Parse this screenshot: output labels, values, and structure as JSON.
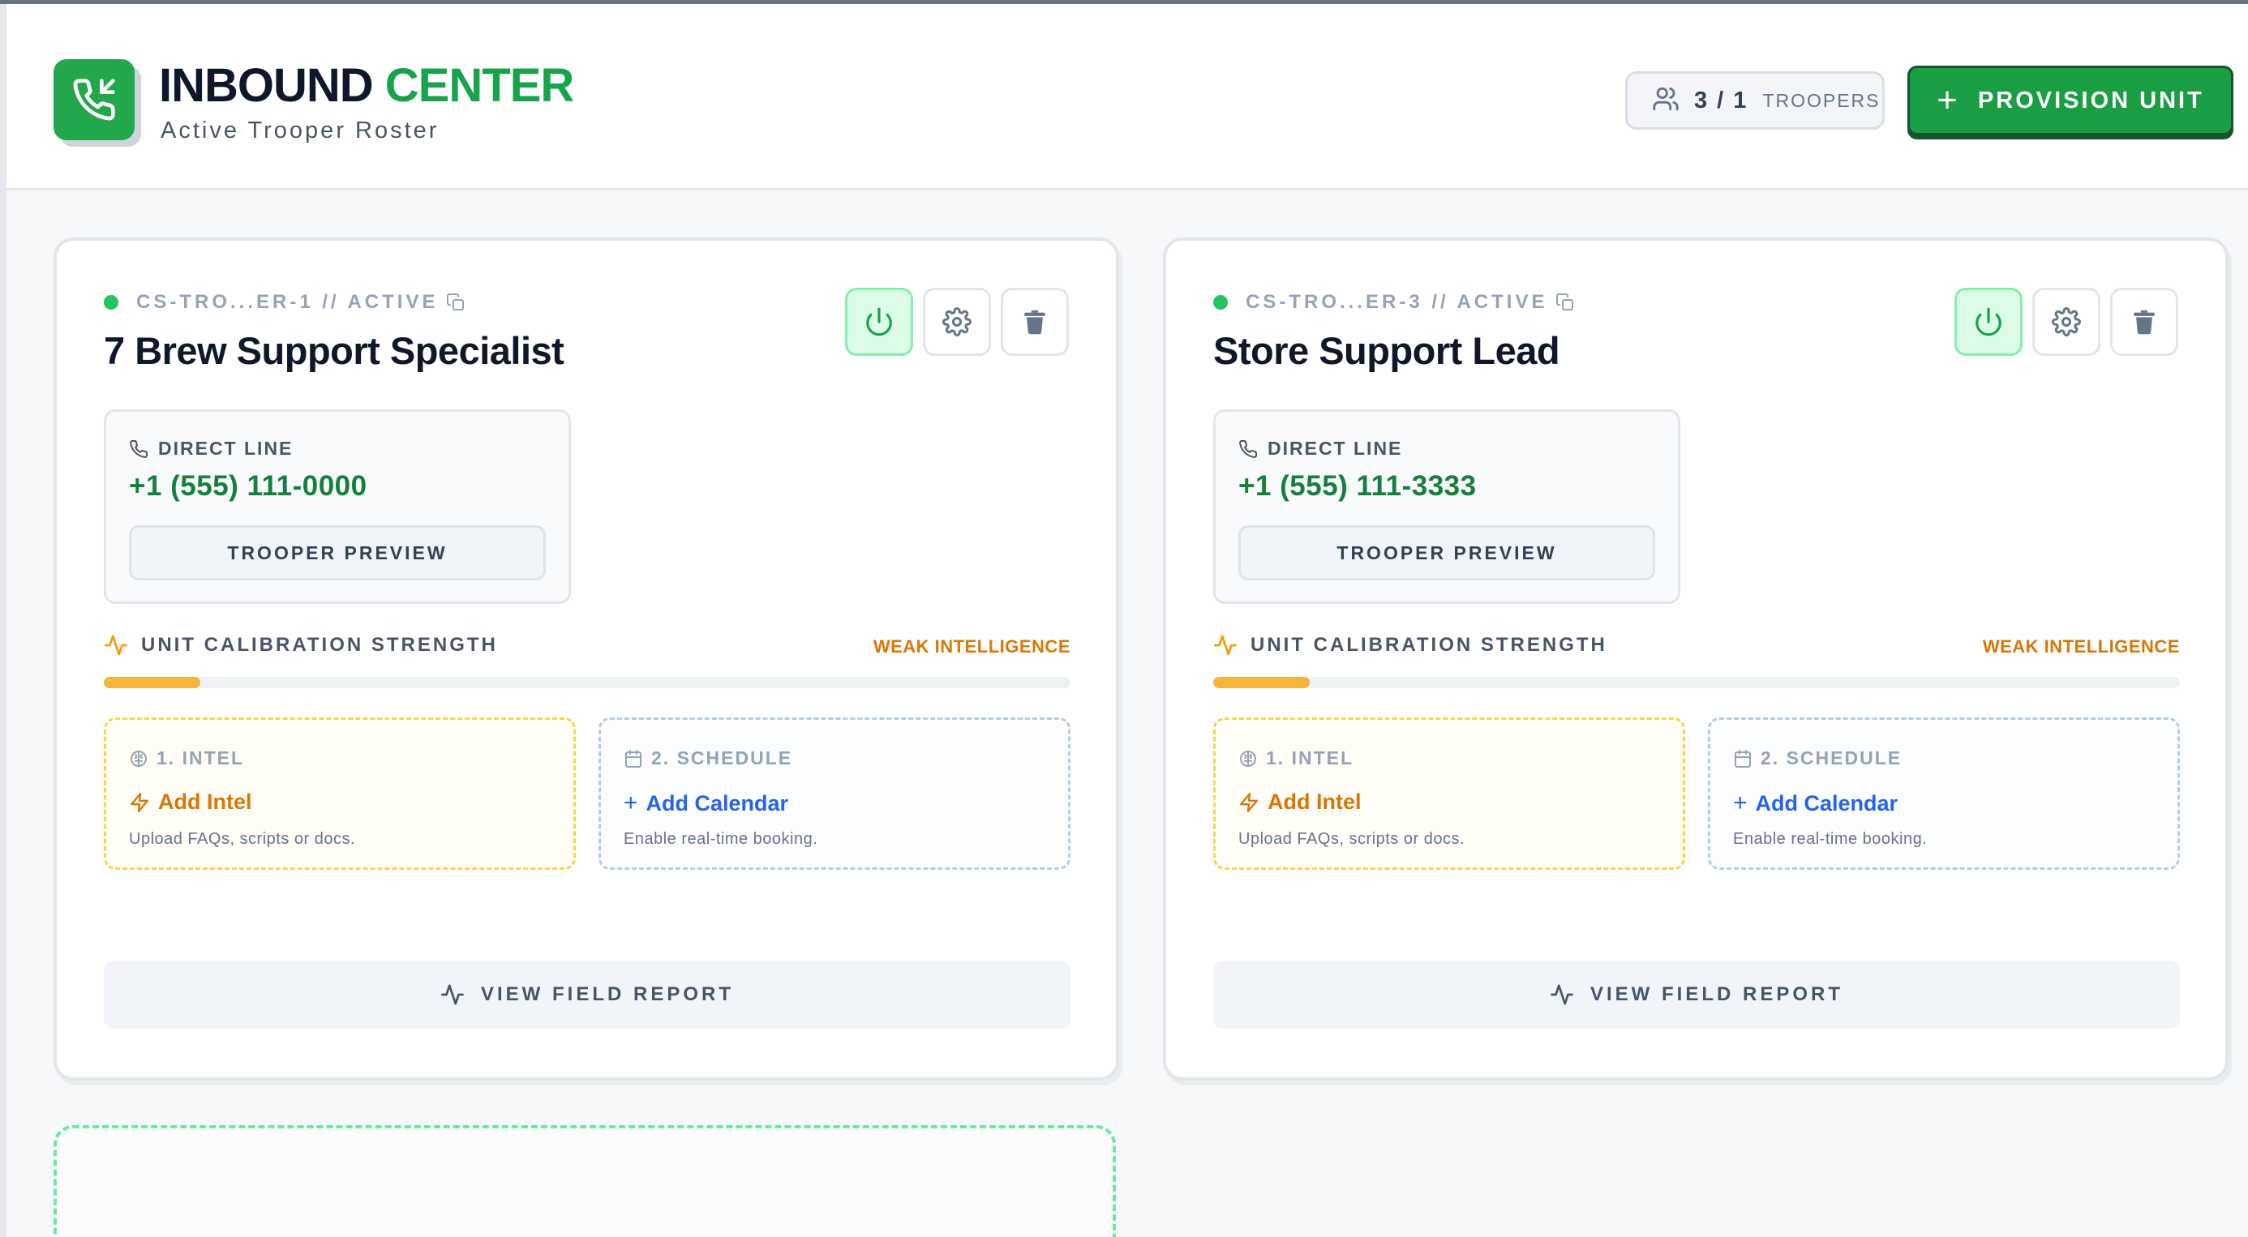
{
  "header": {
    "title_part1": "INBOUND",
    "title_part2": "CENTER",
    "subtitle": "Active Trooper Roster",
    "trooper_count": "3 / 1",
    "trooper_label": "TROOPERS",
    "provision_plus": "+",
    "provision_label": "PROVISION UNIT"
  },
  "colors": {
    "brand_green": "#22a74a",
    "accent_green_text": "#16a34a",
    "warning_orange": "#d97706",
    "link_blue": "#2563eb",
    "progress_fill": "#f5b43c"
  },
  "cards": [
    {
      "id_label": "CS-TRO...ER-1 // ACTIVE",
      "name": "7 Brew Support Specialist",
      "direct_line_label": "DIRECT LINE",
      "phone": "+1 (555) 111-0000",
      "preview_label": "TROOPER PREVIEW",
      "calibration_label": "UNIT CALIBRATION STRENGTH",
      "calibration_status": "WEAK INTELLIGENCE",
      "calibration_level": 0.1,
      "intel_label": "1. INTEL",
      "intel_action": "Add Intel",
      "intel_desc": "Upload FAQs, scripts or docs.",
      "schedule_label": "2. SCHEDULE",
      "schedule_plus": "+",
      "schedule_action": "Add Calendar",
      "schedule_desc": "Enable real-time booking.",
      "report_label": "VIEW FIELD REPORT"
    },
    {
      "id_label": "CS-TRO...ER-3 // ACTIVE",
      "name": "Store Support Lead",
      "direct_line_label": "DIRECT LINE",
      "phone": "+1 (555) 111-3333",
      "preview_label": "TROOPER PREVIEW",
      "calibration_label": "UNIT CALIBRATION STRENGTH",
      "calibration_status": "WEAK INTELLIGENCE",
      "calibration_level": 0.1,
      "intel_label": "1. INTEL",
      "intel_action": "Add Intel",
      "intel_desc": "Upload FAQs, scripts or docs.",
      "schedule_label": "2. SCHEDULE",
      "schedule_plus": "+",
      "schedule_action": "Add Calendar",
      "schedule_desc": "Enable real-time booking.",
      "report_label": "VIEW FIELD REPORT"
    }
  ]
}
